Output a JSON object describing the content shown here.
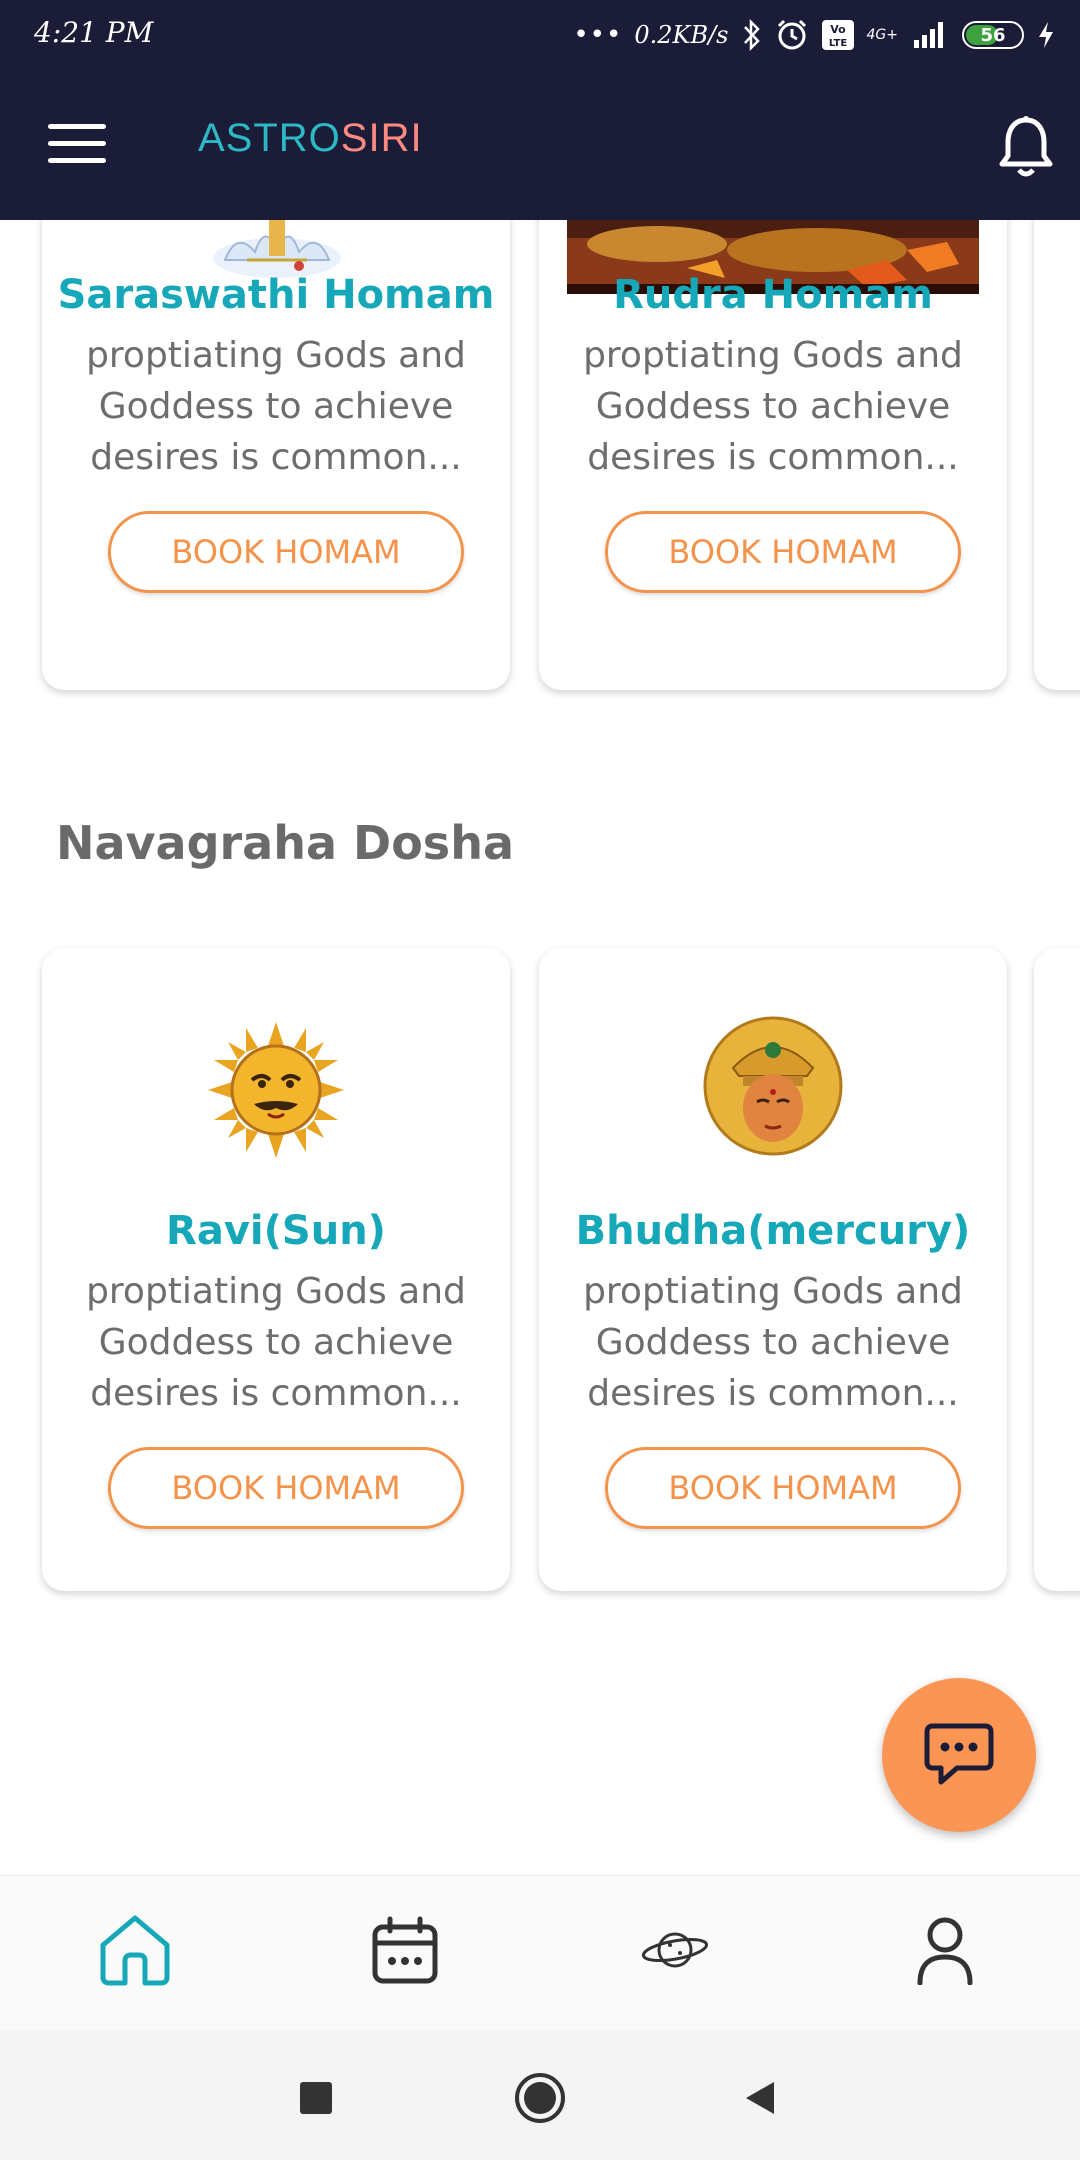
{
  "status_bar": {
    "time": "4:21 PM",
    "speed": "0.2KB/s",
    "network": "4G+",
    "battery": "56"
  },
  "app_bar": {
    "title_part1": "ASTRO",
    "title_part2": "SIRI"
  },
  "homam_cards": [
    {
      "title": "Saraswathi Homam",
      "description": "proptiating Gods and Goddess to achieve desires is common...",
      "button": "BOOK HOMAM"
    },
    {
      "title": "Rudra Homam",
      "description": "proptiating Gods and Goddess to achieve desires is common...",
      "button": "BOOK HOMAM"
    }
  ],
  "navagraha": {
    "section_title": "Navagraha Dosha",
    "cards": [
      {
        "title": "Ravi(Sun)",
        "description": "proptiating Gods and Goddess to achieve desires is common...",
        "button": "BOOK HOMAM"
      },
      {
        "title": "Bhudha(mercury)",
        "description": "proptiating Gods and Goddess to achieve desires is common...",
        "button": "BOOK HOMAM"
      }
    ]
  },
  "bottom_nav": {
    "items": [
      "home-icon",
      "calendar-icon",
      "planet-icon",
      "profile-icon"
    ],
    "active_color": "#16a7b9"
  },
  "colors": {
    "header_bg": "#1b1c38",
    "accent_teal": "#16a7b9",
    "accent_orange": "#f4934b",
    "fab_bg": "#fb9554"
  }
}
